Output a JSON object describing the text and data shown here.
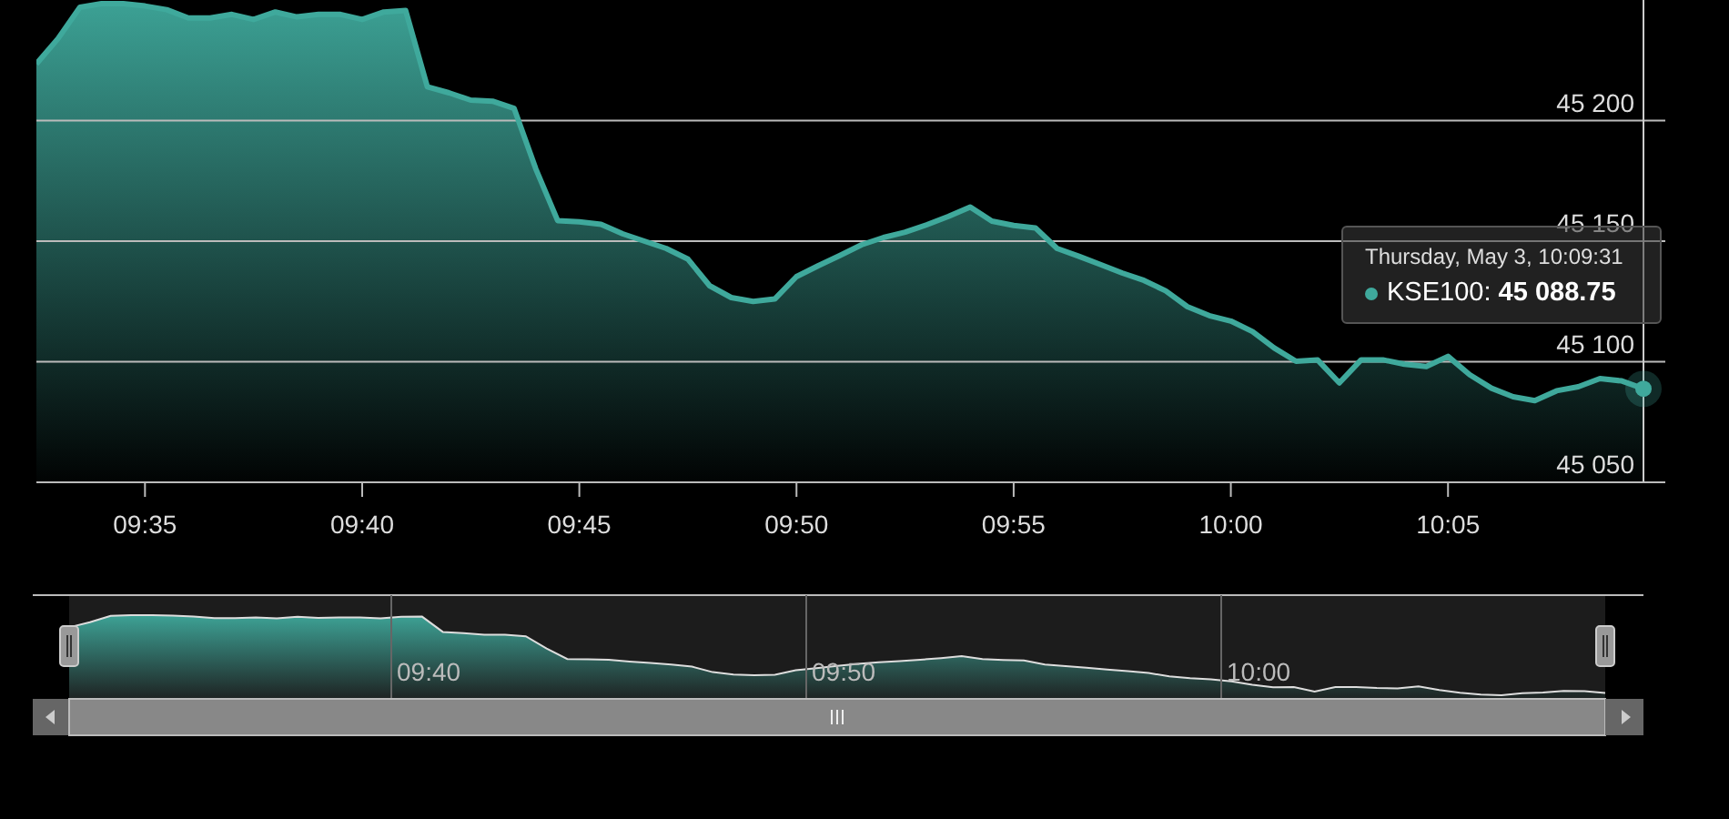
{
  "chart": {
    "chart_data": {
      "type": "area",
      "categories": [
        null,
        null,
        null,
        null,
        null,
        "09:35",
        null,
        null,
        null,
        null,
        null,
        null,
        null,
        null,
        null,
        "09:40",
        null,
        null,
        null,
        null,
        null,
        null,
        null,
        null,
        null,
        "09:45",
        null,
        null,
        null,
        null,
        null,
        null,
        null,
        null,
        null,
        "09:50",
        null,
        null,
        null,
        null,
        null,
        null,
        null,
        null,
        null,
        "09:55",
        null,
        null,
        null,
        null,
        null,
        null,
        null,
        null,
        null,
        "10:00",
        null,
        null,
        null,
        null,
        null,
        null,
        null,
        null,
        null,
        "10:05",
        null,
        null,
        null,
        null,
        null,
        null,
        null,
        null,
        null
      ],
      "series": [
        {
          "name": "KSE100",
          "color": "#3fa99c",
          "values": [
            45223.5,
            45234.0,
            45247.0,
            45248.5,
            45248.5,
            45247.5,
            45246.0,
            45242.5,
            45242.5,
            45244.0,
            45241.9,
            45245.0,
            45243.0,
            45244.0,
            45244.0,
            45241.9,
            45245.0,
            45245.6,
            45214.0,
            45211.5,
            45208.5,
            45208.0,
            45205.0,
            45180.0,
            45158.5,
            45158.0,
            45157.0,
            45153.0,
            45150.0,
            45147.0,
            45142.5,
            45131.5,
            45126.6,
            45125.0,
            45126.0,
            45135.3,
            45139.8,
            45144.0,
            45148.5,
            45151.5,
            45153.7,
            45156.8,
            45160.3,
            45164.2,
            45158.3,
            45156.5,
            45155.5,
            45147.0,
            45143.7,
            45140.3,
            45136.8,
            45133.7,
            45129.4,
            45122.8,
            45119.1,
            45116.9,
            45112.5,
            45105.7,
            45100.2,
            45100.7,
            45091.2,
            45100.8,
            45100.8,
            45099.0,
            45098.0,
            45102.2,
            45094.6,
            45089.0,
            45085.5,
            45083.9,
            45088.0,
            45089.6,
            45093.0,
            45092.0,
            45088.8
          ]
        }
      ],
      "ylim": [
        45050,
        45250
      ],
      "grid": true,
      "yticks": [
        {
          "value": 45050,
          "label": "45 050"
        },
        {
          "value": 45100,
          "label": "45 100"
        },
        {
          "value": 45150,
          "label": "45 150"
        },
        {
          "value": 45200,
          "label": "45 200"
        }
      ]
    }
  },
  "tooltip": {
    "date": "Thursday, May 3, 10:09:31",
    "name_suffix": ":",
    "value": "45 088.75"
  },
  "navigator": {
    "labels": [
      "09:40",
      "09:50",
      "10:00"
    ]
  }
}
